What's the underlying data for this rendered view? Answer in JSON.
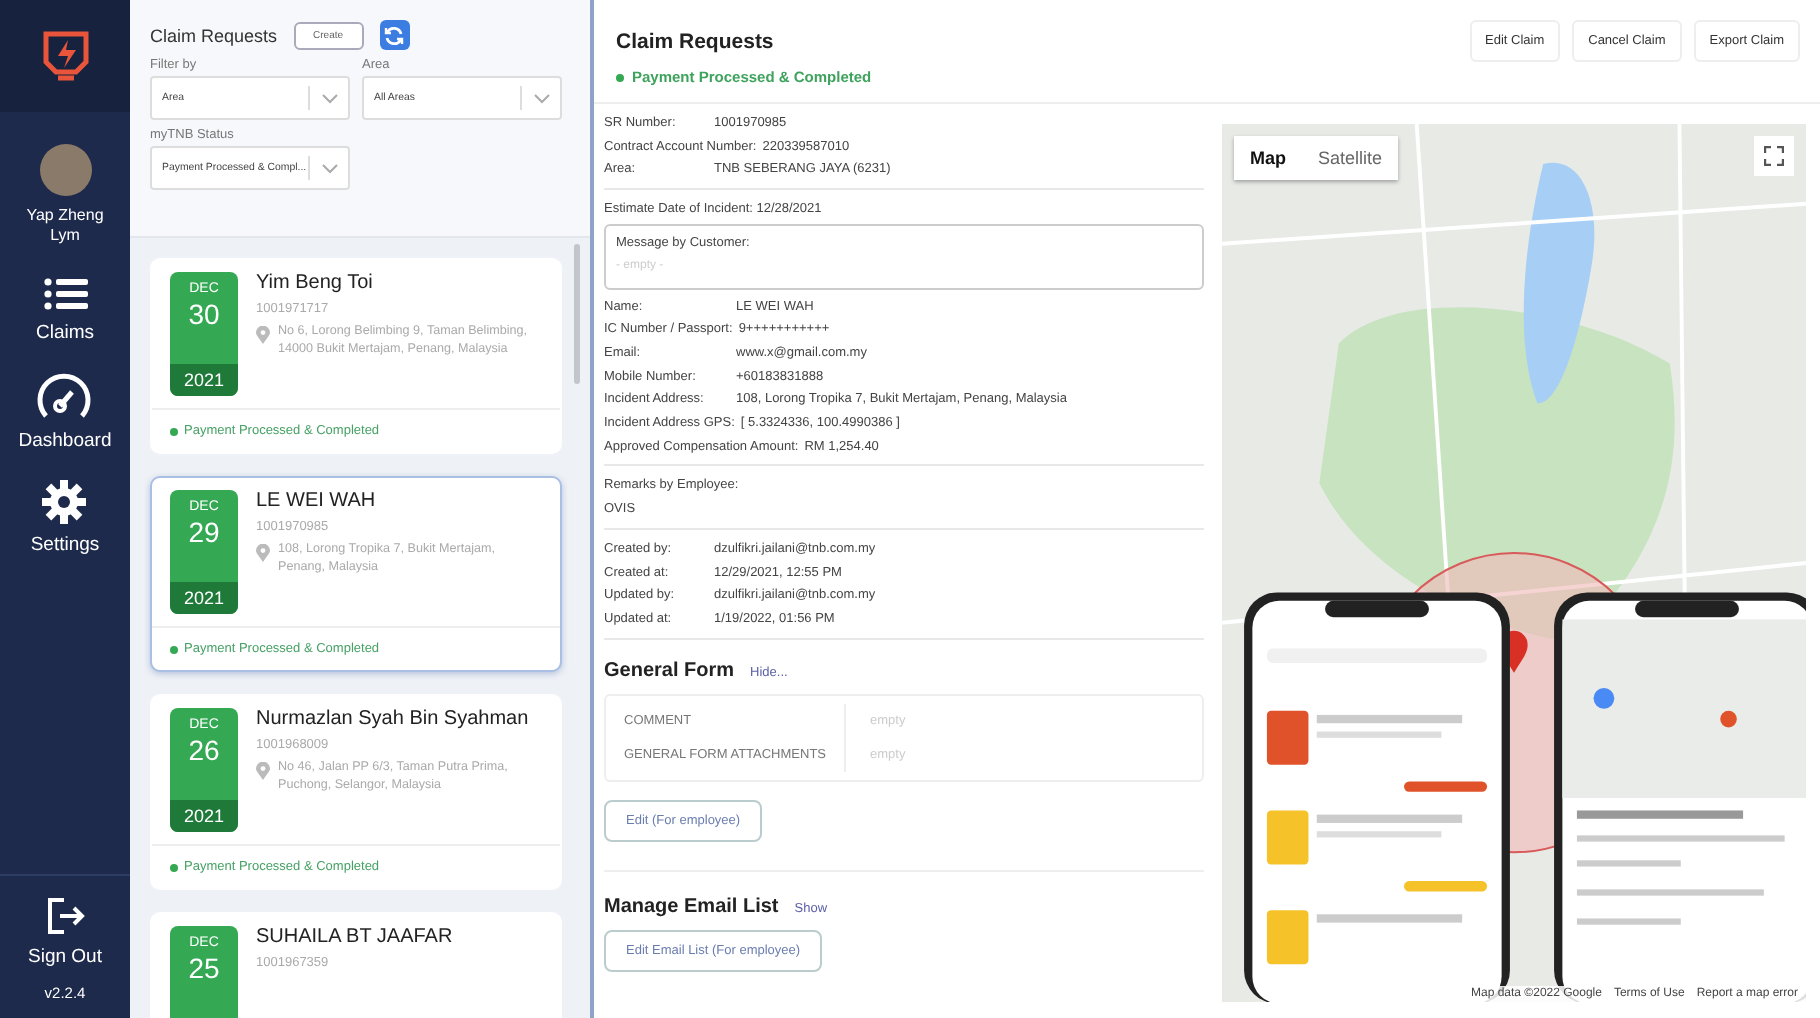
{
  "sidebar": {
    "user": {
      "name": "Yap Zheng Lym"
    },
    "items": [
      {
        "kind": "list",
        "label": "Claims"
      },
      {
        "kind": "gauge",
        "label": "Dashboard"
      },
      {
        "kind": "gear",
        "label": "Settings"
      }
    ],
    "sign_out": "Sign Out",
    "version": "v2.2.4"
  },
  "list_panel": {
    "title": "Claim Requests",
    "create_button": "Create",
    "filters": [
      {
        "label": "Filter by",
        "value": "Area"
      },
      {
        "label": "Area",
        "value": "All Areas"
      },
      {
        "label": "myTNB Status",
        "value": "Payment Processed & Compl..."
      }
    ],
    "claims": [
      {
        "month": "DEC",
        "day": "30",
        "year": "2021",
        "name": "Yim Beng Toi",
        "sr": "1001971717",
        "address": "No 6, Lorong Belimbing 9, Taman Belimbing, 14000 Bukit Mertajam, Penang, Malaysia",
        "status": "Payment Processed & Completed",
        "selected": false
      },
      {
        "month": "DEC",
        "day": "29",
        "year": "2021",
        "name": "LE WEI WAH",
        "sr": "1001970985",
        "address": "108, Lorong Tropika 7, Bukit Mertajam, Penang, Malaysia",
        "status": "Payment Processed & Completed",
        "selected": true
      },
      {
        "month": "DEC",
        "day": "26",
        "year": "2021",
        "name": "Nurmazlan Syah Bin Syahman",
        "sr": "1001968009",
        "address": "No 46, Jalan PP 6/3, Taman Putra Prima, Puchong, Selangor, Malaysia",
        "status": "Payment Processed & Completed",
        "selected": false
      },
      {
        "month": "DEC",
        "day": "25",
        "name": "SUHAILA BT JAAFAR",
        "sr": "1001967359",
        "selected": false
      }
    ]
  },
  "detail": {
    "title": "Claim Requests",
    "status": "Payment Processed & Completed",
    "actions": [
      "Edit Claim",
      "Cancel Claim",
      "Export Claim"
    ],
    "summary": [
      {
        "label": "SR Number:",
        "value": "1001970985"
      },
      {
        "label": "Contract Account Number:",
        "value": "220339587010"
      },
      {
        "label": "Area:",
        "value": "TNB SEBERANG JAYA (6231)"
      }
    ],
    "estimate_date": "Estimate Date of Incident: 12/28/2021",
    "message": {
      "label": "Message by Customer:",
      "placeholder": "- empty -"
    },
    "customer": [
      {
        "label": "Name:",
        "value": "LE WEI WAH"
      },
      {
        "label": "IC Number / Passport:",
        "value": "9+++++++++++"
      },
      {
        "label": "Email:",
        "value": "www.x@gmail.com.my"
      },
      {
        "label": "Mobile Number:",
        "value": "+60183831888"
      },
      {
        "label": "Incident Address:",
        "value": "108, Lorong Tropika 7, Bukit Mertajam, Penang, Malaysia"
      },
      {
        "label": "Incident Address GPS:",
        "value": "[ 5.3324336, 100.4990386 ]"
      },
      {
        "label": "Approved Compensation Amount:",
        "value": "RM 1,254.40"
      }
    ],
    "remarks": {
      "label": "Remarks by Employee:",
      "value": "OVIS"
    },
    "audit": [
      {
        "label": "Created by:",
        "value": "dzulfikri.jailani@tnb.com.my"
      },
      {
        "label": "Created at:",
        "value": "12/29/2021, 12:55 PM"
      },
      {
        "label": "Updated by:",
        "value": "dzulfikri.jailani@tnb.com.my"
      },
      {
        "label": "Updated at:",
        "value": "1/19/2022, 01:56 PM"
      }
    ],
    "general_form": {
      "title": "General Form",
      "toggle": "Hide...",
      "rows": [
        {
          "label": "COMMENT",
          "value": "empty"
        },
        {
          "label": "GENERAL FORM ATTACHMENTS",
          "value": "empty"
        }
      ],
      "button": "Edit (For employee)"
    },
    "email_list": {
      "title": "Manage Email List",
      "toggle": "Show",
      "button": "Edit Email List (For employee)"
    }
  },
  "map": {
    "types": [
      {
        "label": "Map",
        "selected": true
      },
      {
        "label": "Satellite",
        "selected": false
      }
    ],
    "footer": [
      "Map data ©2022 Google",
      "Terms of Use",
      "Report a map error"
    ]
  }
}
